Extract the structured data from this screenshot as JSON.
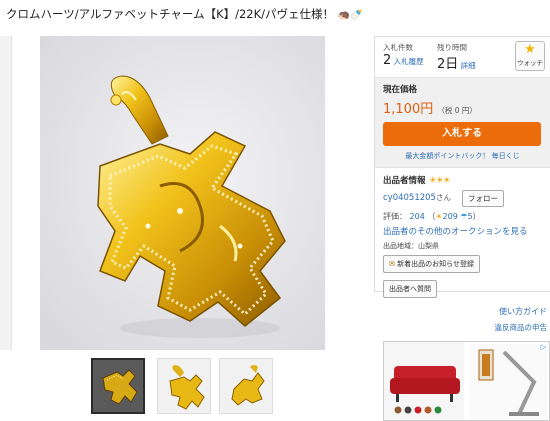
{
  "item": {
    "title": "クロムハーツ/アルファベットチャーム【K】/22K/パヴェ仕様！",
    "title_deco": "🦔🍼"
  },
  "auction": {
    "bids_label": "入札件数",
    "bids_count": "2",
    "bids_history_link": "入札履歴",
    "time_label": "残り時間",
    "time_value": "2日",
    "time_detail_link": "詳細",
    "watch_label": "ウォッチ",
    "current_price_label": "現在価格",
    "price": "1,100円",
    "tax": "（税 0 円）",
    "bid_button": "入札する",
    "promo_text": "最大金額ポイントバック！ 毎日くじ"
  },
  "seller": {
    "label": "出品者情報",
    "rank_icons": "☀☀☀",
    "id": "cy04051205",
    "honorific": "さん",
    "follow_button": "フォロー",
    "rating_label": "評価：",
    "rating_total": "204",
    "rating_good": "209",
    "rating_bad": "5",
    "rating_open": "（",
    "rating_close": "）",
    "other_auctions_link": "出品者のその他のオークションを見る",
    "region": "出品地域：山梨県",
    "notify_button": "新着出品のお知らせ登録",
    "question_button": "出品者へ質問"
  },
  "links": {
    "guide": "使い方ガイド",
    "report": "違反商品の申告"
  },
  "ad": {
    "mark": "▷"
  },
  "colors": {
    "accent_orange": "#ec6b0a",
    "price_orange": "#e05d0f",
    "link_blue": "#2b6db5",
    "gold": "#e0b21a"
  }
}
